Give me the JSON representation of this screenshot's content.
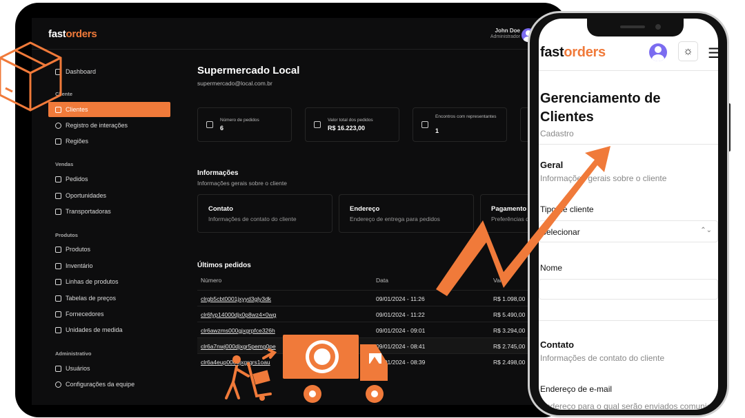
{
  "brand": {
    "part1": "fast",
    "part2": "orders"
  },
  "user": {
    "name": "John Doe",
    "role": "Administrador"
  },
  "sidebar": {
    "dashboard": "Dashboard",
    "groups": {
      "cliente": "Cliente",
      "vendas": "Vendas",
      "produtos": "Produtos",
      "administrativo": "Administrativo"
    },
    "items": {
      "clientes": "Clientes",
      "registro": "Registro de interações",
      "regioes": "Regiões",
      "pedidos": "Pedidos",
      "oportunidades": "Oportunidades",
      "transportadoras": "Transportadoras",
      "produtos": "Produtos",
      "inventario": "Inventário",
      "linhas": "Linhas de produtos",
      "tabelas": "Tabelas de preços",
      "fornecedores": "Fornecedores",
      "unidades": "Unidades de medida",
      "usuarios": "Usuários",
      "configuracoes": "Configurações da equipe"
    }
  },
  "main": {
    "title": "Supermercado Local",
    "email": "supermercado@local.com.br",
    "stats": [
      {
        "label": "Número de pedidos",
        "value": "6"
      },
      {
        "label": "Valor total dos pedidos",
        "value": "R$ 16.223,00"
      },
      {
        "label": "Encontros com representantes",
        "value": "1"
      }
    ],
    "info": {
      "title": "Informações",
      "subtitle": "Informações gerais sobre o cliente"
    },
    "cards": [
      {
        "title": "Contato",
        "desc": "Informações de contato do cliente"
      },
      {
        "title": "Endereço",
        "desc": "Endereço de entrega para pedidos"
      },
      {
        "title": "Pagamento",
        "desc": "Preferências de pagamento"
      }
    ],
    "orders": {
      "title": "Últimos pedidos",
      "headers": [
        "Número",
        "Data",
        "Valor"
      ],
      "rows": [
        [
          "clrgb5cbt0001jxyyd3gly3dk",
          "09/01/2024 - 11:26",
          "R$ 1.098,00"
        ],
        [
          "clr6fyp14000djx0p8wz4×0wg",
          "09/01/2024 - 11:22",
          "R$ 5.490,00"
        ],
        [
          "clr6awzms000gjxgrpfce326h",
          "09/01/2024 - 09:01",
          "R$ 3.294,00"
        ],
        [
          "clr6a7nwj000djxgr5pemg0pe",
          "09/01/2024 - 08:41",
          "R$ 2.745,00"
        ],
        [
          "clr6a4eup0008jxgrqrs1oau",
          "09/01/2024 - 08:39",
          "R$ 2.498,00"
        ]
      ]
    }
  },
  "mobile": {
    "title": "Gerenciamento de Clientes",
    "subtitle": "Cadastro",
    "geral_title": "Geral",
    "geral_desc": "Informações gerais sobre o cliente",
    "tipo_label": "Tipo de cliente",
    "tipo_value": "Selecionar",
    "nome_label": "Nome",
    "contato_title": "Contato",
    "contato_desc": "Informações de contato do cliente",
    "email_label": "Endereço de e-mail",
    "email_desc": "Endereço para o qual serão enviados comunicados"
  },
  "colors": {
    "accent": "#f07a3a",
    "dark_bg": "#0d0d0e",
    "avatar": "#7b6cf0"
  }
}
